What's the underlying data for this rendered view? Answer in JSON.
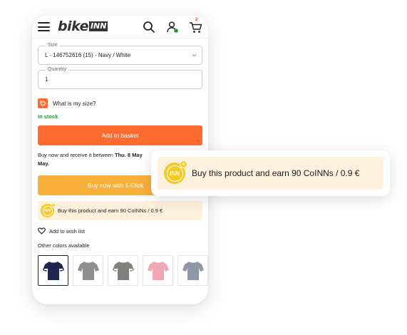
{
  "header": {
    "logo_text": "bike",
    "logo_badge": "INN",
    "cart_count": "2"
  },
  "size_field": {
    "label": "Size",
    "value": "L - 146752616 (15) - Navy / White"
  },
  "quantity_field": {
    "label": "Quantity",
    "value": "1"
  },
  "size_help": "What is my size?",
  "stock_status": "In stock",
  "add_to_basket": "Add to basket",
  "delivery": {
    "prefix": "Buy now and receive it between ",
    "date_from": "Thu. 8 May",
    "date_to_end": "May."
  },
  "buy_one_click": "Buy now with 1-Click",
  "coinns": {
    "badge": "INN",
    "text": "Buy this product and earn 90 CoINNs / 0.9 €"
  },
  "wishlist": "Add to wish list",
  "other_colors": "Other colors available",
  "swatch_colors": [
    "#1d2550",
    "#8e8f8d",
    "#7f817c",
    "#f2a7b8",
    "#8d97a8"
  ],
  "colors": {
    "accent": "#ff6a2f",
    "one_click": "#f9b03a",
    "coin": "#f6c928",
    "coin_bg": "#fdf0dc",
    "stock": "#1a9b2b"
  }
}
